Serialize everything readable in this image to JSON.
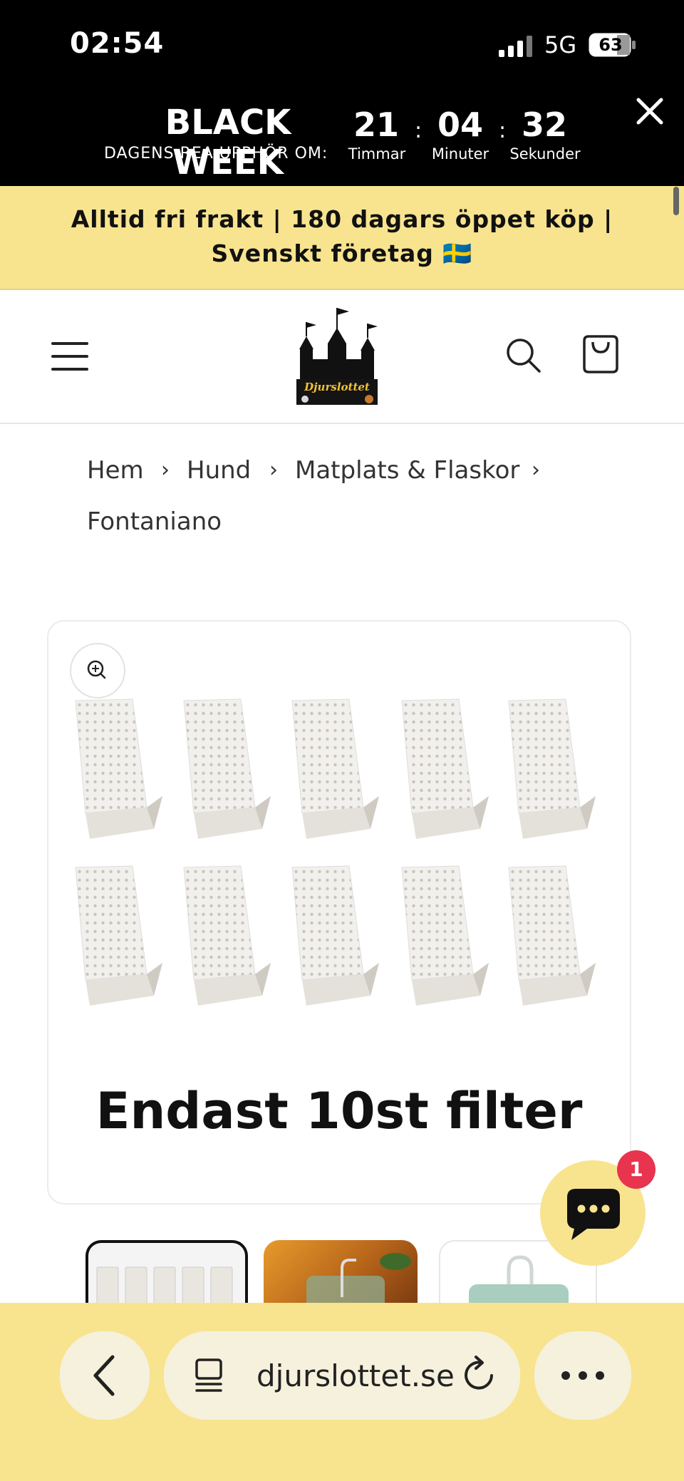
{
  "status_bar": {
    "time": "02:54",
    "network": "5G",
    "battery": "63"
  },
  "promo": {
    "title": "BLACK WEEK",
    "subtitle": "DAGENS REA UPPHÖR OM:",
    "countdown": [
      {
        "value": "21",
        "label": "Timmar"
      },
      {
        "value": "04",
        "label": "Minuter"
      },
      {
        "value": "32",
        "label": "Sekunder"
      }
    ],
    "separator": ":"
  },
  "shipping": {
    "line1": "Alltid fri frakt | 180 dagars öppet köp |",
    "line2": "Svenskt företag 🇸🇪"
  },
  "header": {
    "logo_text": "Djurslottet"
  },
  "breadcrumb": {
    "items": [
      "Hem",
      "Hund",
      "Matplats & Flaskor",
      "Fontaniano"
    ],
    "separator": "›"
  },
  "product": {
    "image_caption": "Endast 10st filter"
  },
  "chat": {
    "badge_count": "1"
  },
  "browser": {
    "url": "djurslottet.se"
  },
  "colors": {
    "accent_yellow": "#f8e48f",
    "badge_red": "#e8344e",
    "promo_bg": "#000000"
  }
}
